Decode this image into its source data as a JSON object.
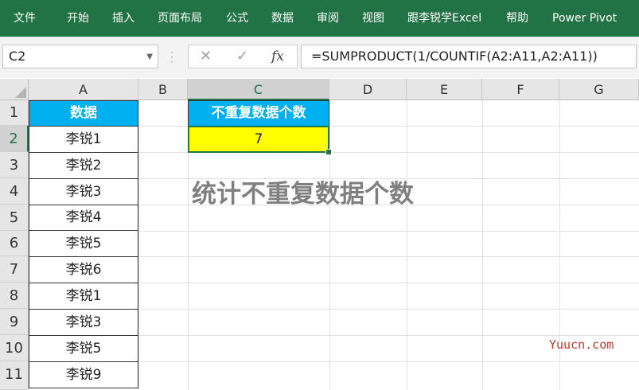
{
  "ribbon": {
    "tabs": [
      "文件",
      "开始",
      "插入",
      "页面布局",
      "公式",
      "数据",
      "审阅",
      "视图",
      "跟李锐学Excel",
      "帮助",
      "Power Pivot"
    ]
  },
  "formula_bar": {
    "name_box": "C2",
    "cancel_icon": "close-icon",
    "enter_icon": "check-icon",
    "fx_label": "fx",
    "formula": "=SUMPRODUCT(1/COUNTIF(A2:A11,A2:A11))"
  },
  "grid": {
    "columns": [
      "A",
      "B",
      "C",
      "D",
      "E",
      "F",
      "G"
    ],
    "selected_column": "C",
    "rows": [
      "1",
      "2",
      "3",
      "4",
      "5",
      "6",
      "7",
      "8",
      "9",
      "10",
      "11"
    ],
    "selected_row": "2",
    "columnA": {
      "header": "数据",
      "values": [
        "李锐1",
        "李锐2",
        "李锐3",
        "李锐4",
        "李锐5",
        "李锐6",
        "李锐1",
        "李锐3",
        "李锐5",
        "李锐9"
      ]
    },
    "c1": "不重复数据个数",
    "c2": "7"
  },
  "annotation": "统计不重复数据个数",
  "watermark": "Yuucn.com",
  "colors": {
    "ribbon": "#217346",
    "header_fill": "#00b0f0",
    "result_fill": "#ffff00",
    "annotation": "#7f7f7f",
    "watermark": "#c0392b"
  }
}
